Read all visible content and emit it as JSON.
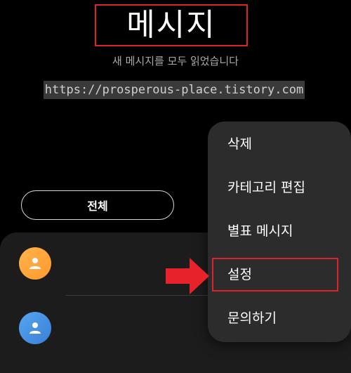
{
  "header": {
    "title": "메시지",
    "subtitle": "새 메시지를 모두 읽었습니다"
  },
  "watermark": {
    "text": "https://prosperous-place.tistory.com"
  },
  "filter": {
    "label": "전체"
  },
  "context_menu": {
    "items": [
      {
        "label": "삭제"
      },
      {
        "label": "카테고리 편집"
      },
      {
        "label": "별표 메시지"
      },
      {
        "label": "설정"
      },
      {
        "label": "문의하기"
      }
    ],
    "highlighted_item": "설정"
  },
  "conversations": [
    {
      "avatar_color": "#ffa53c",
      "avatar_icon": "person-icon"
    },
    {
      "avatar_color": "#4a90e2",
      "avatar_icon": "person-icon"
    }
  ],
  "colors": {
    "background": "#000000",
    "menu_background": "#2c2c2c",
    "annotation_red": "#d9232d"
  }
}
